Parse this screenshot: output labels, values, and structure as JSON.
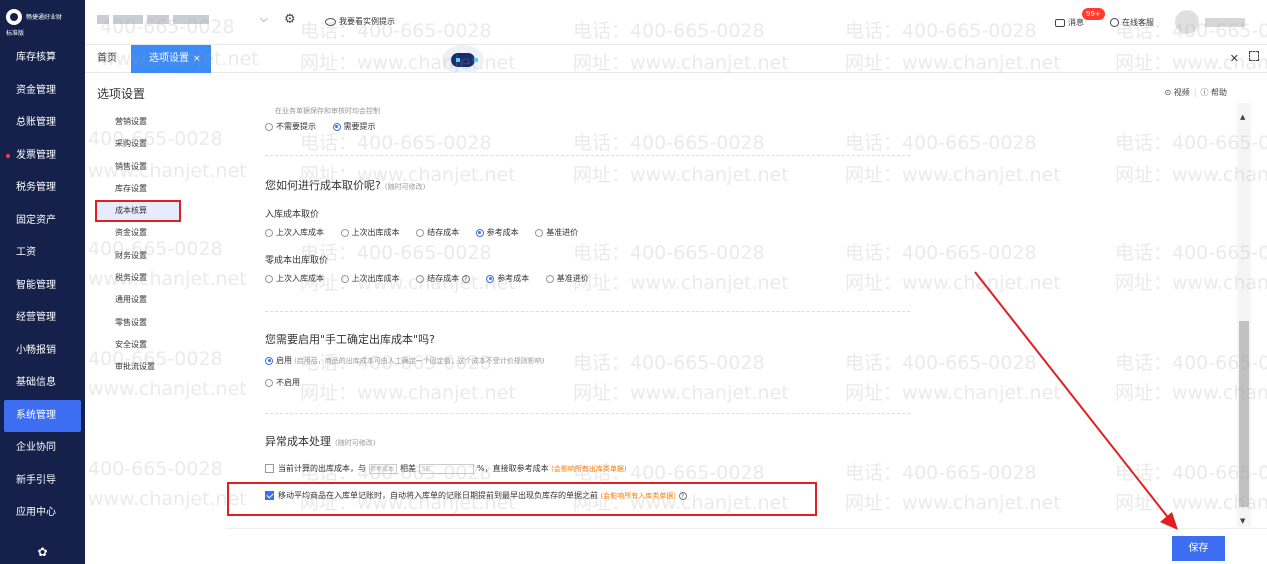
{
  "app": {
    "brand_name": "畅捷通好业财",
    "edition": "标准版"
  },
  "nav": {
    "items": [
      {
        "label": "库存核算"
      },
      {
        "label": "资金管理"
      },
      {
        "label": "总账管理"
      },
      {
        "label": "发票管理"
      },
      {
        "label": "税务管理"
      },
      {
        "label": "固定资产"
      },
      {
        "label": "工资"
      },
      {
        "label": "智能管理"
      },
      {
        "label": "经营管理"
      },
      {
        "label": "小畅报销"
      },
      {
        "label": "基础信息"
      },
      {
        "label": "系统管理"
      },
      {
        "label": "企业协同"
      },
      {
        "label": "新手引导"
      },
      {
        "label": "应用中心"
      }
    ]
  },
  "topbar": {
    "tip_label": "我要看实例提示",
    "messages_label": "消息",
    "messages_badge": "99+",
    "service_label": "在线客服"
  },
  "tabs": {
    "home": "首页",
    "current": "选项设置",
    "close": "×"
  },
  "page": {
    "title": "选项设置",
    "video_label": "视频",
    "help_label": "帮助"
  },
  "subnav": {
    "items": [
      {
        "label": "营销设置"
      },
      {
        "label": "采购设置"
      },
      {
        "label": "销售设置"
      },
      {
        "label": "库存设置"
      },
      {
        "label": "成本核算"
      },
      {
        "label": "资金设置"
      },
      {
        "label": "财务设置"
      },
      {
        "label": "税务设置"
      },
      {
        "label": "通用设置"
      },
      {
        "label": "零售设置"
      },
      {
        "label": "安全设置"
      },
      {
        "label": "审批流设置"
      }
    ]
  },
  "settings": {
    "top_desc": "在业务单据保存和审核时均会控制",
    "top_opt1": "不需要提示",
    "top_opt2": "需要提示",
    "cost_title": "您如何进行成本取价呢?",
    "cost_note": "(随时可修改)",
    "inbound_label": "入库成本取价",
    "inbound_opts": [
      "上次入库成本",
      "上次出库成本",
      "结存成本",
      "参考成本",
      "基准进价"
    ],
    "retail_label": "零成本出库取价",
    "retail_opts": [
      "上次入库成本",
      "上次出库成本",
      "结存成本",
      "参考成本",
      "基准进价"
    ],
    "manual_title": "您需要启用\"手工确定出库成本\"吗?",
    "manual_on": "启用",
    "manual_on_desc": "(启用后，商品的出库成本可由人工确定一个固定值，这个成本不受计价规则影响)",
    "manual_off": "不启用",
    "abn_title": "异常成本处理",
    "abn_note": "(随时可修改)",
    "abn_row1_pre": "当前计算的出库成本，与",
    "abn_row1_select": "参考成本",
    "abn_row1_mid": "相差",
    "abn_row1_input": "50",
    "abn_row1_post": "%，直接取参考成本",
    "abn_row1_warn": "(会影响所有出库类单据)",
    "abn_row2_text": "移动平均商品在入库单记账时，自动将入库单的记账日期提前到最早出现负库存的单据之前",
    "abn_row2_warn": "(会影响所有入库类单据)"
  },
  "footer": {
    "save_label": "保存"
  },
  "watermark": {
    "phone": "电话：400-665-0028",
    "site": "网址：www.chanjet.net",
    "phone_frag": "400-665-0028",
    "site_frag": "www.chanjet.net"
  },
  "colors": {
    "nav_bg": "#15214a",
    "accent": "#3d6df0",
    "highlight_red": "#e02020",
    "warn_orange": "#ff7a00"
  }
}
